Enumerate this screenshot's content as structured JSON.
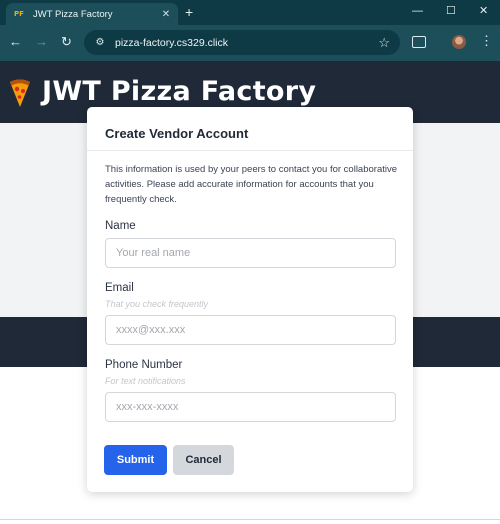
{
  "browser": {
    "tab": {
      "favicon_text": "PF",
      "title": "JWT Pizza Factory",
      "close_glyph": "✕"
    },
    "new_tab_glyph": "+",
    "window_controls": {
      "minimize": "—",
      "maximize": "☐",
      "close": "✕"
    },
    "nav": {
      "back": "←",
      "forward": "→",
      "reload": "↻"
    },
    "url": "pizza-factory.cs329.click",
    "bookmark_glyph": "☆",
    "menu_glyph": "⋮"
  },
  "site": {
    "title": "JWT Pizza Factory",
    "header_color": "#1f2937"
  },
  "modal": {
    "title": "Create Vendor Account",
    "description": "This information is used by your peers to contact you for collaborative activities. Please add accurate information for accounts that you frequently check.",
    "fields": {
      "name": {
        "label": "Name",
        "placeholder": "Your real name",
        "value": ""
      },
      "email": {
        "label": "Email",
        "hint": "That you check frequently",
        "placeholder": "xxxx@xxx.xxx",
        "value": ""
      },
      "phone": {
        "label": "Phone Number",
        "hint": "For text notifications",
        "placeholder": "xxx-xxx-xxxx",
        "value": ""
      }
    },
    "buttons": {
      "submit": "Submit",
      "cancel": "Cancel"
    },
    "accent_color": "#2563eb"
  }
}
